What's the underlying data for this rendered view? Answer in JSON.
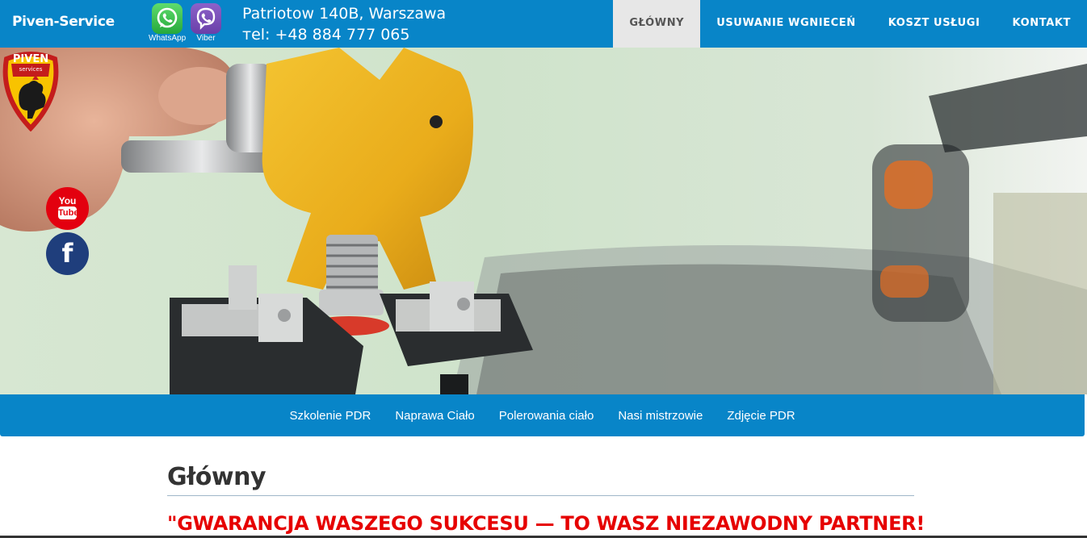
{
  "header": {
    "brand": "Piven-Service",
    "messengers": [
      {
        "label": "WhatsApp",
        "color": "#25d366"
      },
      {
        "label": "Viber",
        "color": "#7b519d"
      }
    ],
    "address_line": "Patriotow 140B, Warszawa",
    "phone_line": "тel: +48 884 777 065",
    "nav": [
      {
        "label": "Główny",
        "active": true
      },
      {
        "label": "Usuwanie wgnieceń",
        "active": false
      },
      {
        "label": "Koszt usługi",
        "active": false
      },
      {
        "label": "Kontakt",
        "active": false
      }
    ],
    "bar_color": "#0885c8"
  },
  "hero": {
    "logo_text": "PIVEN",
    "logo_subtext": "services",
    "social": {
      "youtube_top": "You",
      "youtube_bottom": "Tube",
      "facebook": "f"
    }
  },
  "subnav": [
    "Szkolenie PDR",
    "Naprawa Ciało",
    "Polerowania ciało",
    "Nasi mistrzowie",
    "Zdjęcie PDR"
  ],
  "content": {
    "title": "Główny",
    "tagline": "\"GWARANCJA WASZEGO SUKCESU — TO WASZ NIEZAWODNY PARTNER!",
    "accent_color": "#e60000"
  }
}
